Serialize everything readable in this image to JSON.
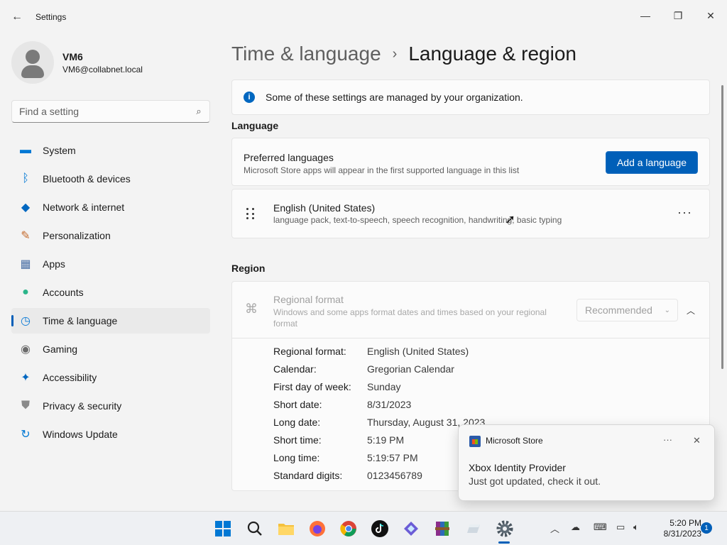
{
  "window": {
    "title": "Settings",
    "back_icon": "←",
    "min_icon": "—",
    "max_icon": "❐",
    "close_icon": "✕"
  },
  "profile": {
    "name": "VM6",
    "email": "VM6@collabnet.local"
  },
  "search": {
    "placeholder": "Find a setting",
    "icon": "⌕"
  },
  "nav": {
    "items": [
      {
        "label": "System",
        "icon": "▬",
        "color": "#0078d4"
      },
      {
        "label": "Bluetooth & devices",
        "icon": "ᛒ",
        "color": "#0078d4"
      },
      {
        "label": "Network & internet",
        "icon": "◆",
        "color": "#0067c0"
      },
      {
        "label": "Personalization",
        "icon": "✎",
        "color": "#c46b2d"
      },
      {
        "label": "Apps",
        "icon": "▦",
        "color": "#4a6fa5"
      },
      {
        "label": "Accounts",
        "icon": "●",
        "color": "#2bb58a"
      },
      {
        "label": "Time & language",
        "icon": "◷",
        "color": "#0a7ad6"
      },
      {
        "label": "Gaming",
        "icon": "◉",
        "color": "#6b6b6b"
      },
      {
        "label": "Accessibility",
        "icon": "✦",
        "color": "#0067c0"
      },
      {
        "label": "Privacy & security",
        "icon": "⛊",
        "color": "#8a8a8a"
      },
      {
        "label": "Windows Update",
        "icon": "↻",
        "color": "#0078d4"
      }
    ],
    "active_index": 6
  },
  "breadcrumb": {
    "parent": "Time & language",
    "separator": "›",
    "current": "Language & region"
  },
  "info_bar": {
    "icon": "i",
    "text": "Some of these settings are managed by your organization."
  },
  "language": {
    "heading": "Language",
    "preferred_title": "Preferred languages",
    "preferred_sub": "Microsoft Store apps will appear in the first supported language in this list",
    "add_button": "Add a language",
    "entry_title": "English (United States)",
    "entry_sub": "language pack, text-to-speech, speech recognition, handwriting, basic typing",
    "more_icon": "···"
  },
  "region": {
    "heading": "Region",
    "format_title": "Regional format",
    "format_sub": "Windows and some apps format dates and times based on your regional format",
    "dropdown_value": "Recommended",
    "chevron_down": "⌄",
    "collapse_icon": "︿",
    "rows": [
      {
        "label": "Regional format:",
        "value": "English (United States)"
      },
      {
        "label": "Calendar:",
        "value": "Gregorian Calendar"
      },
      {
        "label": "First day of week:",
        "value": "Sunday"
      },
      {
        "label": "Short date:",
        "value": "8/31/2023"
      },
      {
        "label": "Long date:",
        "value": "Thursday, August 31, 2023"
      },
      {
        "label": "Short time:",
        "value": "5:19 PM"
      },
      {
        "label": "Long time:",
        "value": "5:19:57 PM"
      },
      {
        "label": "Standard digits:",
        "value": "0123456789"
      }
    ]
  },
  "toast": {
    "app": "Microsoft Store",
    "more_icon": "···",
    "close_icon": "✕",
    "title": "Xbox Identity Provider",
    "body": "Just got updated, check it out."
  },
  "taskbar": {
    "clock_time": "5:20 PM",
    "clock_date": "8/31/2023",
    "notification_count": "1"
  }
}
